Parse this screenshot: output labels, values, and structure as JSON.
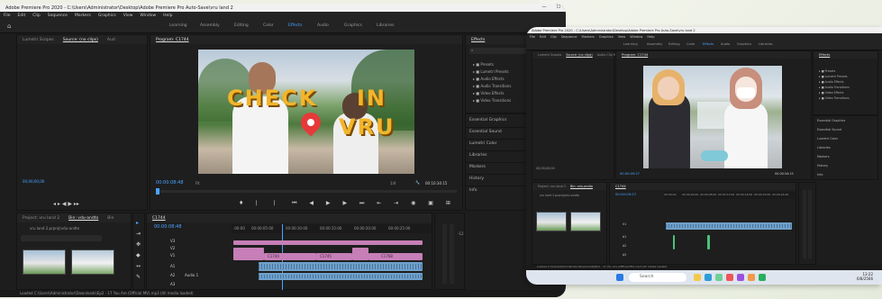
{
  "left": {
    "title": "Adobe Premiere Pro 2020 - C:\\Users\\Administrator\\Desktop\\Adobe Premiere Pro Auto-Save\\vru land 2",
    "menu": [
      "File",
      "Edit",
      "Clip",
      "Sequence",
      "Markers",
      "Graphics",
      "View",
      "Window",
      "Help"
    ],
    "workspaces": [
      "Learning",
      "Assembly",
      "Editing",
      "Color",
      "Effects",
      "Audio",
      "Graphics",
      "Libraries"
    ],
    "active_workspace": "Effects",
    "source_tabs": [
      "Lumetri Scopes",
      "Source: (no clips)",
      "Aud"
    ],
    "source_timecode": "00;00;00;00",
    "program_tab": "Program: C1744",
    "program_timecode": "00:00:08:48",
    "program_fit": "Fit",
    "program_fraction": "1/4",
    "program_duration": "00:10:34:15",
    "overlay_word1": "CHECK",
    "overlay_word2": "IN",
    "overlay_word3": "VRU",
    "effects_title": "Effects",
    "effects_list": [
      "Presets",
      "Lumetri Presets",
      "Audio Effects",
      "Audio Transitions",
      "Video Effects",
      "Video Transitions"
    ],
    "side_panels": [
      "Essential Graphics",
      "Essential Sound",
      "Lumetri Color",
      "Libraries",
      "Markers",
      "History",
      "Info"
    ],
    "project_tabs": [
      "Project: vru land 2",
      "Bin: vdu-andto",
      "Bin"
    ],
    "project_item": "vru land 2.prproj\\vdu-andto",
    "timeline_tab": "C1744",
    "timeline_timecode": "00:00:08:48",
    "ruler_labels": [
      ":00:00",
      "00:00:05:00",
      "00:00:10:00",
      "00:00:15:00",
      "00:00:20:00",
      "00:00:25:00"
    ],
    "track_labels": [
      "V3",
      "V2",
      "V1",
      "A1",
      "A2",
      "A3"
    ],
    "audio_track_name": "Audio 1",
    "video_clip_labels": [
      "C1744",
      "C1745",
      "C1764",
      "C1768"
    ],
    "status": "Loaded C:\\Users\\Administrator\\Downloads\\Ep2 - 17 You Are (Official MV).mp3 (All media loaded)"
  },
  "right": {
    "title": "Adobe Premiere Pro 2020 - C:\\Users\\Administrator\\Desktop\\Adobe Premiere Pro Auto-Save\\vru land 2",
    "menu": [
      "File",
      "Edit",
      "Clip",
      "Sequence",
      "Markers",
      "Graphics",
      "View",
      "Window",
      "Help"
    ],
    "workspaces": [
      "Learning",
      "Assembly",
      "Editing",
      "Color",
      "Effects",
      "Audio",
      "Graphics",
      "Libraries"
    ],
    "active_workspace": "Effects",
    "source_tabs": [
      "Lumetri Scopes",
      "Source: (no clips)",
      "Audio Clip Mixer"
    ],
    "source_timecode": "00;00;00;00",
    "program_tab": "Program: C1744",
    "program_timecode": "00:00:09:27",
    "program_duration": "00:00:34:15",
    "effects_title": "Effects",
    "effects_list": [
      "Presets",
      "Lumetri Presets",
      "Audio Effects",
      "Audio Transitions",
      "Video Effects",
      "Video Transitions"
    ],
    "side_panels": [
      "Essential Graphics",
      "Essential Sound",
      "Lumetri Color",
      "Libraries",
      "Markers",
      "History",
      "Info"
    ],
    "project_tabs": [
      "Project: vru land 2",
      "Bin: vdu-andto"
    ],
    "project_item": "vru land 2.prproj\\vdu-andto",
    "timeline_tab": "C1744",
    "timeline_timecode": "00:00:09:27",
    "ruler_labels": [
      "00:00:00",
      "00:00:04:00",
      "00:00:08:00",
      "00:00:12:00",
      "00:00:16:00",
      "00:00:20:00",
      "00:00:24:00",
      "00:00:28:00"
    ],
    "track_labels": [
      "V3",
      "V2",
      "V1",
      "A1",
      "A2",
      "A3"
    ],
    "status": "Loaded C:\\Users\\Administrator\\Downloads\\Ep2 - 17 You Are (Official MV).mp3 (All media loaded)",
    "search_placeholder": "Search",
    "clock_time": "13:22",
    "clock_date": "6/8/2566"
  },
  "colors": {
    "accent": "#4aa3ff",
    "video_clip": "#c67fb7",
    "audio_clip": "#6fa0c9"
  }
}
